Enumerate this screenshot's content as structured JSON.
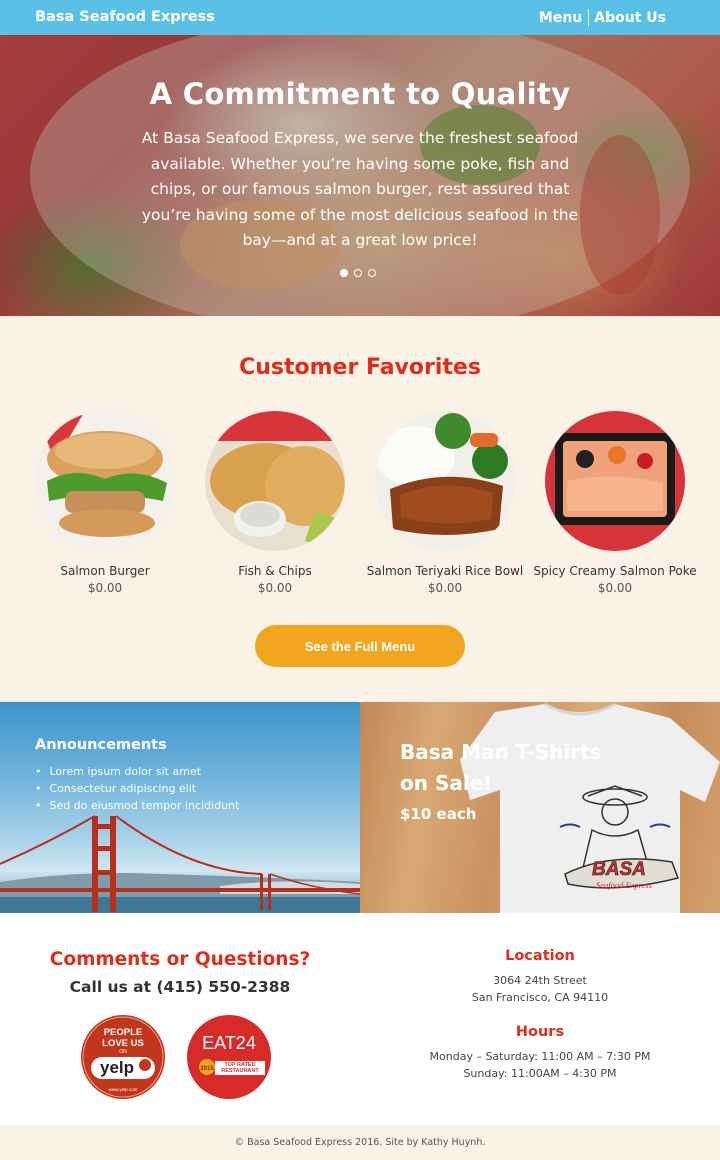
{
  "nav": {
    "brand": "Basa Seafood Express",
    "links": [
      "Menu",
      "About Us"
    ]
  },
  "hero": {
    "title": "A Commitment to Quality",
    "text": "At Basa Seafood Express, we serve the freshest seafood available. Whether you’re having some poke, fish and chips, or our famous salmon burger, rest assured that you’re having some of the most delicious seafood in the bay—and at a great low price!",
    "slides": 3,
    "active_slide": 1
  },
  "favorites": {
    "title": "Customer Favorites",
    "items": [
      {
        "name": "Salmon Burger",
        "price": "$0.00"
      },
      {
        "name": "Fish & Chips",
        "price": "$0.00"
      },
      {
        "name": "Salmon Teriyaki Rice Bowl",
        "price": "$0.00"
      },
      {
        "name": "Spicy Creamy Salmon Poke",
        "price": "$0.00"
      }
    ],
    "button": "See the Full Menu"
  },
  "announcements": {
    "title": "Announcements",
    "items": [
      "Lorem ipsum dolor sit amet",
      "Consectetur adipiscing elit",
      "Sed do eiusmod tempor incididunt"
    ]
  },
  "promo": {
    "title": "Basa Man T-Shirts on Sale!",
    "price": "$10 each",
    "shirt_logo": "BASA",
    "shirt_subtitle": "Seafood Express"
  },
  "contact": {
    "title": "Comments or Questions?",
    "phone": "Call us at (415) 550-2388",
    "badges": {
      "yelp": {
        "line1": "PEOPLE",
        "line2": "LOVE US",
        "line3": "ON",
        "brand": "yelp",
        "url": "www.yelp.com"
      },
      "eat24": {
        "brand": "EAT24",
        "year": "2015",
        "label": "TOP RATED RESTAURANT"
      }
    },
    "location_title": "Location",
    "address": [
      "3064 24th Street",
      "San Francisco, CA 94110"
    ],
    "hours_title": "Hours",
    "hours": [
      "Monday – Saturday: 11:00 AM – 7:30 PM",
      "Sunday: 11:00AM – 4:30 PM"
    ]
  },
  "footer": "© Basa Seafood Express 2016. Site by Kathy Huynh.",
  "colors": {
    "nav": "#5bc0e6",
    "accent_red": "#dd2d1c",
    "button": "#f2a51f",
    "cream": "#faf2e7"
  }
}
